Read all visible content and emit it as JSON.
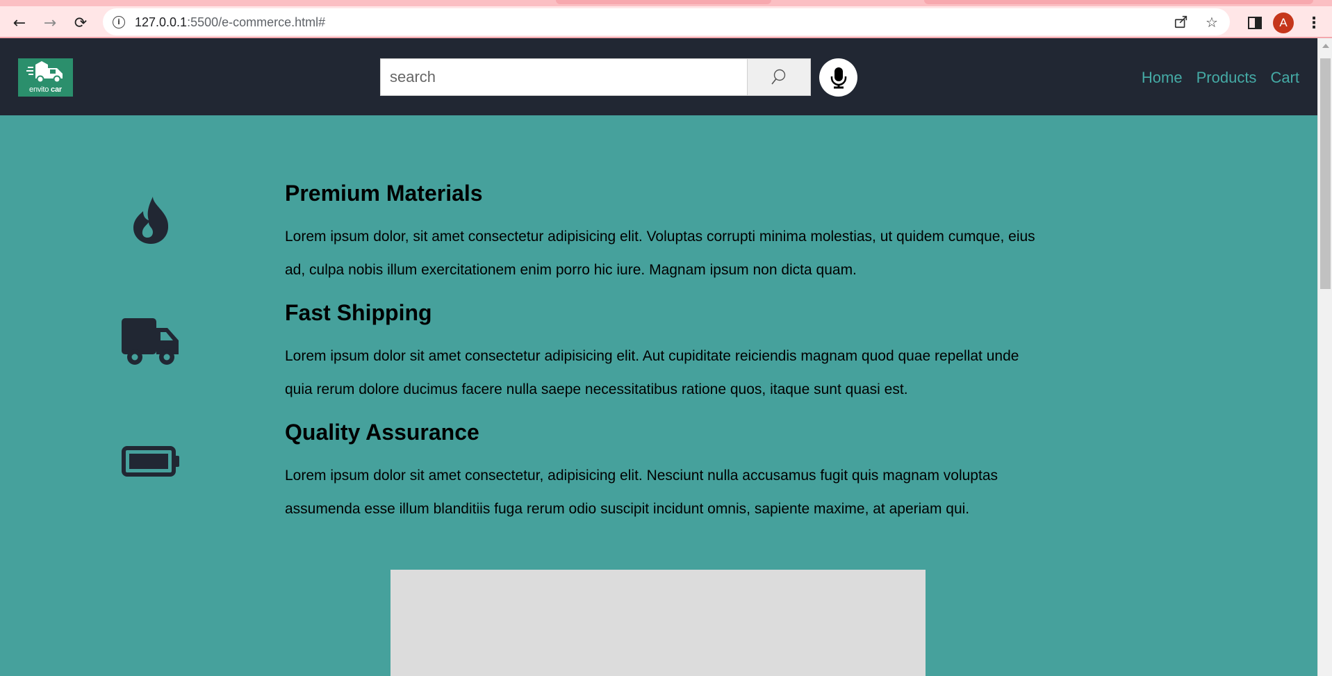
{
  "browser": {
    "url_host": "127.0.0.1",
    "url_rest": ":5500/e-commerce.html#",
    "avatar_letter": "A"
  },
  "header": {
    "logo_text_light": "envito",
    "logo_text_bold": "car",
    "search_placeholder": "search",
    "nav": {
      "home": "Home",
      "products": "Products",
      "cart": "Cart"
    }
  },
  "features": [
    {
      "icon": "fire-icon",
      "title": "Premium Materials",
      "text": "Lorem ipsum dolor, sit amet consectetur adipisicing elit. Voluptas corrupti minima molestias, ut quidem cumque, eius ad, culpa nobis illum exercitationem enim porro hic iure. Magnam ipsum non dicta quam."
    },
    {
      "icon": "truck-icon",
      "title": "Fast Shipping",
      "text": "Lorem ipsum dolor sit amet consectetur adipisicing elit. Aut cupiditate reiciendis magnam quod quae repellat unde quia rerum dolore ducimus facere nulla saepe necessitatibus ratione quos, itaque sunt quasi est."
    },
    {
      "icon": "battery-icon",
      "title": "Quality Assurance",
      "text": "Lorem ipsum dolor sit amet consectetur, adipisicing elit. Nesciunt nulla accusamus fugit quis magnam voluptas assumenda esse illum blanditiis fuga rerum odio suscipit incidunt omnis, sapiente maxime, at aperiam qui."
    }
  ],
  "colors": {
    "page_background": "#46a19c",
    "header_background": "#212733",
    "nav_link": "#45aba6",
    "icon_dark": "#212733",
    "logo_background": "#2b8f6c"
  }
}
